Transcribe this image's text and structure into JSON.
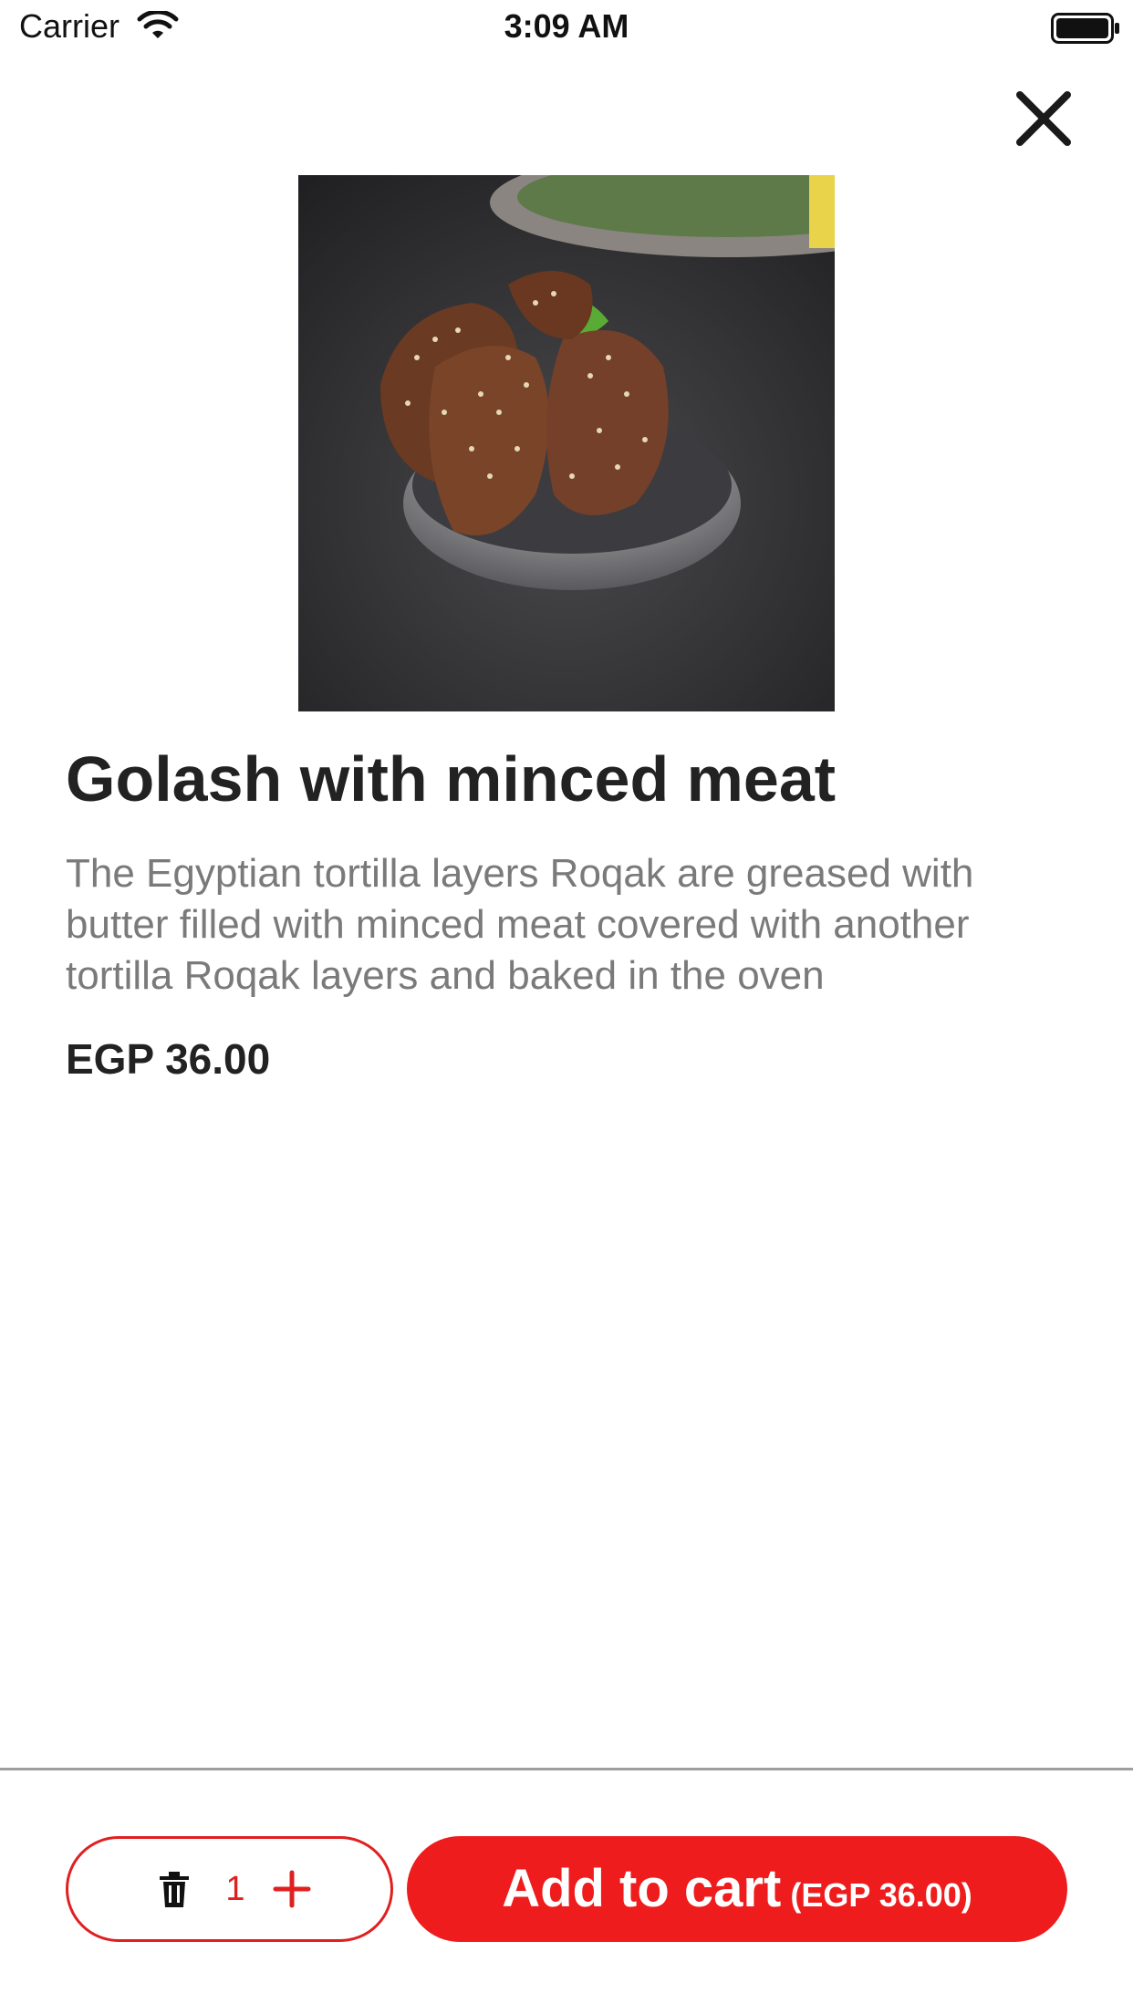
{
  "status_bar": {
    "carrier": "Carrier",
    "time": "3:09 AM",
    "wifi_icon": "wifi-icon",
    "battery_icon": "battery-full-icon"
  },
  "header": {
    "close_icon": "close-icon"
  },
  "product": {
    "image_subject": "food-photo",
    "title": "Golash with minced meat",
    "description": "The Egyptian tortilla layers Roqak  are greased with butter filled with minced meat covered with another tortilla Roqak layers and baked in the oven",
    "price": "EGP 36.00"
  },
  "footer": {
    "quantity": "1",
    "trash_icon": "trash-icon",
    "plus_icon": "plus-icon",
    "add_to_cart_label": "Add to cart",
    "add_to_cart_price": "(EGP 36.00)"
  },
  "colors": {
    "accent": "#ee1c1c",
    "title_text": "#222222",
    "description_text": "#7a7a7a",
    "divider": "#9e9e9e"
  }
}
